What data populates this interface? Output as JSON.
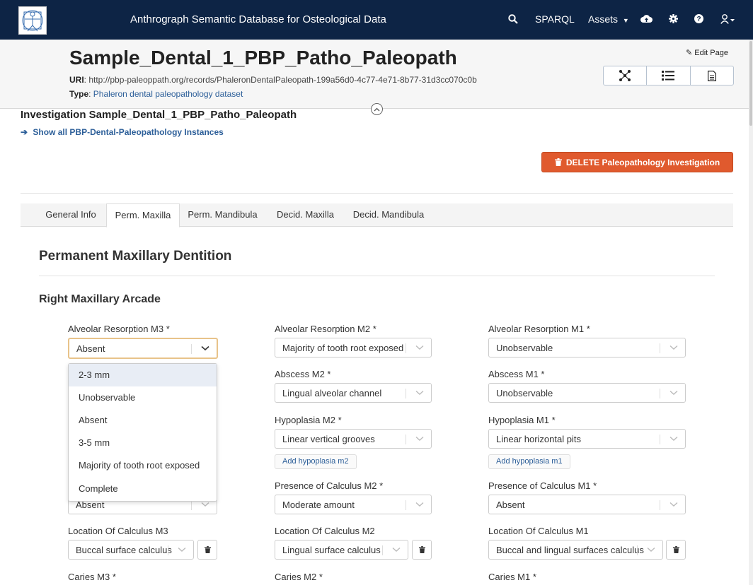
{
  "navbar": {
    "app_title": "Anthrograph Semantic Database for Osteological Data",
    "sparql": "SPARQL",
    "assets": "Assets"
  },
  "record": {
    "title": "Sample_Dental_1_PBP_Patho_Paleopath",
    "uri_label": "URI",
    "uri": "http://pbp-paleoppath.org/records/PhaleronDentalPaleopath-199a56d0-4c77-4e71-8b77-31d3cc070c0b",
    "type_label": "Type",
    "type": "Phaleron dental paleopathology dataset",
    "edit_page": "Edit Page"
  },
  "investigation": {
    "title": "Investigation Sample_Dental_1_PBP_Patho_Paleopath",
    "show_all": "Show all PBP-Dental-Paleopathology Instances",
    "delete": "DELETE Paleopathology Investigation"
  },
  "tabs": [
    "General Info",
    "Perm. Maxilla",
    "Perm. Mandibula",
    "Decid. Maxilla",
    "Decid. Mandibula"
  ],
  "section": {
    "title": "Permanent Maxillary Dentition",
    "subtitle": "Right Maxillary Arcade"
  },
  "fields": {
    "m3": {
      "alveolar_label": "Alveolar Resorption M3 *",
      "alveolar_value": "Absent",
      "presence_value": "Absent",
      "location_label": "Location Of Calculus M3",
      "location_value": "Buccal surface calculus",
      "caries_label": "Caries M3 *"
    },
    "m2": {
      "alveolar_label": "Alveolar Resorption M2 *",
      "alveolar_value": "Majority of tooth root exposed",
      "abscess_label": "Abscess M2 *",
      "abscess_value": "Lingual alveolar channel",
      "hypoplasia_label": "Hypoplasia M2 *",
      "hypoplasia_value": "Linear vertical grooves",
      "add_hypoplasia": "Add hypoplasia m2",
      "presence_label": "Presence of Calculus M2 *",
      "presence_value": "Moderate amount",
      "location_label": "Location Of Calculus M2",
      "location_value": "Lingual surface calculus",
      "caries_label": "Caries M2 *"
    },
    "m1": {
      "alveolar_label": "Alveolar Resorption M1 *",
      "alveolar_value": "Unobservable",
      "abscess_label": "Abscess M1 *",
      "abscess_value": "Unobservable",
      "hypoplasia_label": "Hypoplasia M1 *",
      "hypoplasia_value": "Linear horizontal pits",
      "add_hypoplasia": "Add hypoplasia m1",
      "presence_label": "Presence of Calculus M1 *",
      "presence_value": "Absent",
      "location_label": "Location Of Calculus M1",
      "location_value": "Buccal and lingual surfaces calculus",
      "caries_label": "Caries M1 *"
    }
  },
  "dropdown_options": [
    "2-3 mm",
    "Unobservable",
    "Absent",
    "3-5 mm",
    "Majority of tooth root exposed",
    "Complete"
  ],
  "colors": {
    "navbar": "#0d2445",
    "delete": "#e05a2e",
    "link": "#2d5f99",
    "focus": "#e8c38a"
  }
}
